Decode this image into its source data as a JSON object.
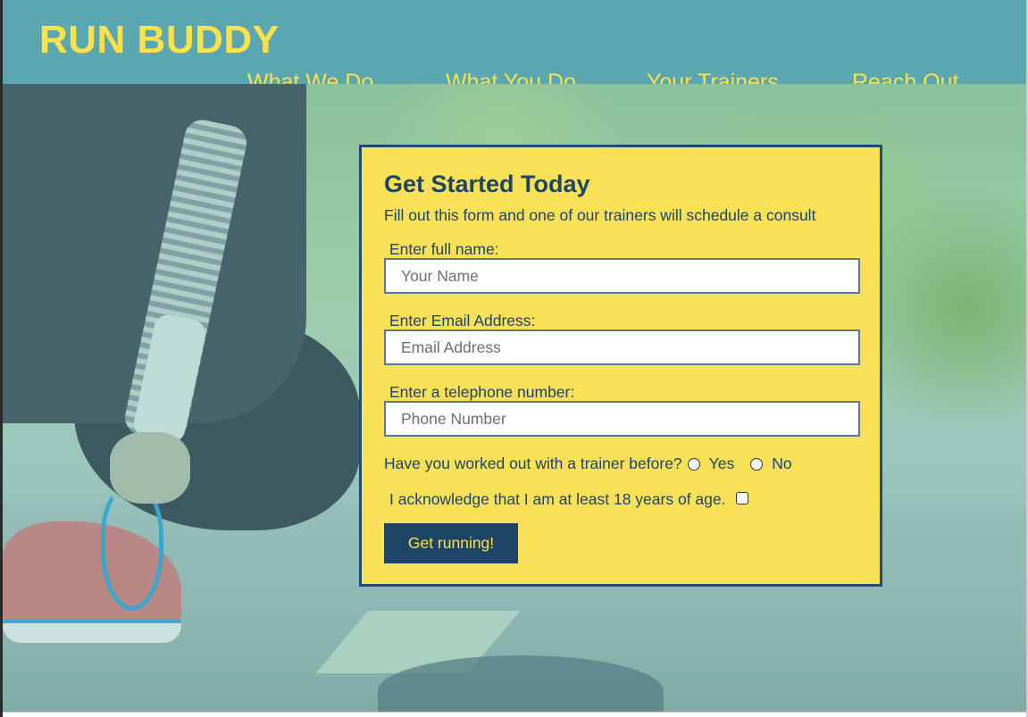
{
  "header": {
    "brand": "RUN BUDDY",
    "nav": [
      {
        "label": "What We Do"
      },
      {
        "label": "What You Do"
      },
      {
        "label": "Your Trainers"
      },
      {
        "label": "Reach Out"
      }
    ]
  },
  "form": {
    "title": "Get Started Today",
    "subtitle": "Fill out this form and one of our trainers will schedule a consult",
    "name_label": "Enter full name:",
    "name_placeholder": "Your Name",
    "email_label": "Enter Email Address:",
    "email_placeholder": "Email Address",
    "phone_label": "Enter a telephone number:",
    "phone_placeholder": "Phone Number",
    "trainer_question": "Have you worked out with a trainer before?",
    "radio_yes": "Yes",
    "radio_no": "No",
    "age_ack": "I acknowledge that I am at least 18 years of age.",
    "submit_label": "Get running!"
  },
  "colors": {
    "header_bg": "#5aa6b1",
    "brand_yellow": "#fce14b",
    "form_bg": "#f8e057",
    "navy": "#1d4566"
  }
}
